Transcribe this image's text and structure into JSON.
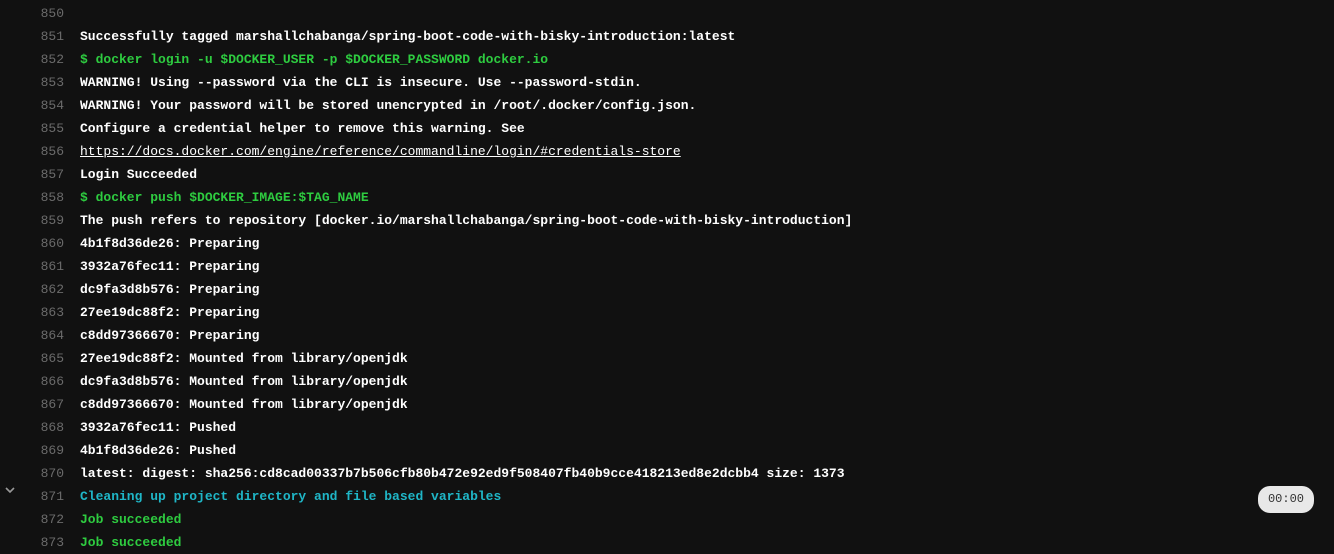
{
  "timer": "00:00",
  "lines": [
    {
      "num": "850",
      "chevron": false,
      "cls": "c-dim",
      "badge": false,
      "text": ""
    },
    {
      "num": "851",
      "chevron": false,
      "cls": "c-white",
      "badge": false,
      "text": "Successfully tagged marshallchabanga/spring-boot-code-with-bisky-introduction:latest"
    },
    {
      "num": "852",
      "chevron": false,
      "cls": "c-command",
      "badge": false,
      "text": "$ docker login -u $DOCKER_USER -p $DOCKER_PASSWORD docker.io"
    },
    {
      "num": "853",
      "chevron": false,
      "cls": "c-white",
      "badge": false,
      "text": "WARNING! Using --password via the CLI is insecure. Use --password-stdin."
    },
    {
      "num": "854",
      "chevron": false,
      "cls": "c-white",
      "badge": false,
      "text": "WARNING! Your password will be stored unencrypted in /root/.docker/config.json."
    },
    {
      "num": "855",
      "chevron": false,
      "cls": "c-white",
      "badge": false,
      "text": "Configure a credential helper to remove this warning. See"
    },
    {
      "num": "856",
      "chevron": false,
      "cls": "c-link",
      "badge": false,
      "text": "https://docs.docker.com/engine/reference/commandline/login/#credentials-store"
    },
    {
      "num": "857",
      "chevron": false,
      "cls": "c-white",
      "badge": false,
      "text": "Login Succeeded"
    },
    {
      "num": "858",
      "chevron": false,
      "cls": "c-command",
      "badge": false,
      "text": "$ docker push $DOCKER_IMAGE:$TAG_NAME"
    },
    {
      "num": "859",
      "chevron": false,
      "cls": "c-white",
      "badge": false,
      "text": "The push refers to repository [docker.io/marshallchabanga/spring-boot-code-with-bisky-introduction]"
    },
    {
      "num": "860",
      "chevron": false,
      "cls": "c-white",
      "badge": false,
      "text": "4b1f8d36de26: Preparing"
    },
    {
      "num": "861",
      "chevron": false,
      "cls": "c-white",
      "badge": false,
      "text": "3932a76fec11: Preparing"
    },
    {
      "num": "862",
      "chevron": false,
      "cls": "c-white",
      "badge": false,
      "text": "dc9fa3d8b576: Preparing"
    },
    {
      "num": "863",
      "chevron": false,
      "cls": "c-white",
      "badge": false,
      "text": "27ee19dc88f2: Preparing"
    },
    {
      "num": "864",
      "chevron": false,
      "cls": "c-white",
      "badge": false,
      "text": "c8dd97366670: Preparing"
    },
    {
      "num": "865",
      "chevron": false,
      "cls": "c-white",
      "badge": false,
      "text": "27ee19dc88f2: Mounted from library/openjdk"
    },
    {
      "num": "866",
      "chevron": false,
      "cls": "c-white",
      "badge": false,
      "text": "dc9fa3d8b576: Mounted from library/openjdk"
    },
    {
      "num": "867",
      "chevron": false,
      "cls": "c-white",
      "badge": false,
      "text": "c8dd97366670: Mounted from library/openjdk"
    },
    {
      "num": "868",
      "chevron": false,
      "cls": "c-white",
      "badge": false,
      "text": "3932a76fec11: Pushed"
    },
    {
      "num": "869",
      "chevron": false,
      "cls": "c-white",
      "badge": false,
      "text": "4b1f8d36de26: Pushed"
    },
    {
      "num": "870",
      "chevron": false,
      "cls": "c-white",
      "badge": false,
      "text": "latest: digest: sha256:cd8cad00337b7b506cfb80b472e92ed9f508407fb40b9cce418213ed8e2dcbb4 size: 1373"
    },
    {
      "num": "871",
      "chevron": true,
      "cls": "c-cyan",
      "badge": true,
      "text": "Cleaning up project directory and file based variables"
    },
    {
      "num": "872",
      "chevron": false,
      "cls": "c-green",
      "badge": false,
      "text": "Job succeeded"
    },
    {
      "num": "873",
      "chevron": false,
      "cls": "c-green",
      "badge": false,
      "text": "Job succeeded"
    }
  ]
}
